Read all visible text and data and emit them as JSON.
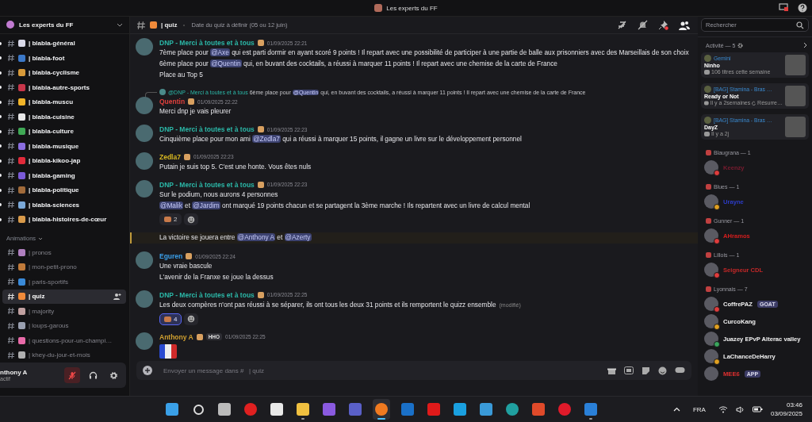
{
  "window": {
    "title": "Les experts du FF"
  },
  "server": {
    "name": "Les experts du FF"
  },
  "channels": [
    {
      "name": "| blabla-général",
      "unread": true,
      "selected": false,
      "color": "#d9d9e8"
    },
    {
      "name": "| blabla-foot",
      "unread": true,
      "selected": false,
      "color": "#3b78c8"
    },
    {
      "name": "| blabla-cyclisme",
      "unread": true,
      "selected": false,
      "color": "#d79a3a"
    },
    {
      "name": "| blabla-autre-sports",
      "unread": true,
      "selected": false,
      "color": "#c8364a"
    },
    {
      "name": "| blabla-muscu",
      "unread": true,
      "selected": false,
      "color": "#f0b429"
    },
    {
      "name": "| blabla-cuisine",
      "unread": true,
      "selected": false,
      "color": "#e8e8e8"
    },
    {
      "name": "| blabla-culture",
      "unread": true,
      "selected": false,
      "color": "#3fa855"
    },
    {
      "name": "| blabla-musique",
      "unread": true,
      "selected": false,
      "color": "#8a6de0"
    },
    {
      "name": "| blabla-kikoo-jap",
      "unread": true,
      "selected": false,
      "color": "#e02a3a"
    },
    {
      "name": "| blabla-gaming",
      "unread": true,
      "selected": false,
      "color": "#7a5ad8"
    },
    {
      "name": "| blabla-politique",
      "unread": true,
      "selected": false,
      "color": "#a06a3a"
    },
    {
      "name": "| blabla-sciences",
      "unread": true,
      "selected": false,
      "color": "#7aa8d8"
    },
    {
      "name": "| blabla-histoires-de-cœur",
      "unread": true,
      "selected": false,
      "color": "#d89a4a"
    }
  ],
  "category": {
    "name": "Animations",
    "channels": [
      {
        "name": "| pronos",
        "unread": false,
        "selected": false,
        "color": "#b080c0"
      },
      {
        "name": "| mon-petit-prono",
        "unread": false,
        "selected": false,
        "color": "#c07a3a"
      },
      {
        "name": "| paris-sportifs",
        "unread": false,
        "selected": false,
        "color": "#3a8ad8"
      },
      {
        "name": "| quiz",
        "unread": true,
        "selected": true,
        "color": "#f08a3a"
      },
      {
        "name": "| majority",
        "unread": false,
        "selected": false,
        "color": "#c0a0a0"
      },
      {
        "name": "| loups-garous",
        "unread": false,
        "selected": false,
        "color": "#9aa0b0"
      },
      {
        "name": "| questions-pour-un-champi…",
        "unread": false,
        "selected": false,
        "color": "#e86aa8"
      },
      {
        "name": "| khey-du-jour-et-mois",
        "unread": false,
        "selected": false,
        "color": "#b0b0b0"
      }
    ]
  },
  "user_panel": {
    "name": "nthony A",
    "status": "actif",
    "muted": true
  },
  "chat_header": {
    "channel": "| quiz",
    "topic": "Date du quiz à définir (05 ou 12 juin)"
  },
  "search": {
    "placeholder": "Rechercher"
  },
  "messages": [
    {
      "kind": "message",
      "author": "DNP - Merci à toutes et à tous",
      "color": "#2bb8a8",
      "time": "01/09/2025 22:21",
      "lines": [
        [
          {
            "text": "7ème place pour ",
            "mention": false
          },
          {
            "text": "@Axe",
            "mention": true
          },
          {
            "text": " qui est parti dormir en ayant scoré 9 points ! Il repart avec une possibilité de participer à une partie de balle aux prisonniers avec des Marseillais de son choix",
            "mention": false
          }
        ],
        [
          {
            "text": "6ème place pour ",
            "mention": false
          },
          {
            "text": "@Quentin",
            "mention": true
          },
          {
            "text": " qui, en buvant des cocktails, a réussi à marquer 11 points ! Il repart avec une chemise de la carte de France",
            "mention": false
          }
        ],
        [
          {
            "text": "Place au Top 5",
            "mention": false
          }
        ]
      ]
    },
    {
      "kind": "message",
      "author": "Quentin",
      "color": "#e0403c",
      "time": "01/09/2025 22:22",
      "reply": {
        "author": "@DNP - Merci à toutes et à tous",
        "parts": [
          {
            "text": "6ème place pour ",
            "mention": false
          },
          {
            "text": "@Quentin",
            "mention": true
          },
          {
            "text": " qui, en buvant des cocktails, a réussi à marquer 11 points ! Il repart avec une chemise de la carte de France",
            "mention": false
          }
        ]
      },
      "lines": [
        [
          {
            "text": "Merci dnp je vais pleurer",
            "mention": false
          }
        ]
      ]
    },
    {
      "kind": "message",
      "author": "DNP - Merci à toutes et à tous",
      "color": "#2bb8a8",
      "time": "01/09/2025 22:23",
      "lines": [
        [
          {
            "text": "Cinquième place pour mon ami ",
            "mention": false
          },
          {
            "text": "@Zedla7",
            "mention": true
          },
          {
            "text": " qui a réussi à marquer 15 points, il gagne un livre sur le développement personnel",
            "mention": false
          }
        ]
      ]
    },
    {
      "kind": "message",
      "author": "Zedla7",
      "color": "#d8b820",
      "time": "01/09/2025 22:23",
      "lines": [
        [
          {
            "text": "Putain je suis top 5. C'est une honte. Vous êtes nuls",
            "mention": false
          }
        ]
      ]
    },
    {
      "kind": "message",
      "author": "DNP - Merci à toutes et à tous",
      "color": "#2bb8a8",
      "time": "01/09/2025 22:23",
      "lines": [
        [
          {
            "text": "Sur le podium, nous aurons 4 personnes",
            "mention": false
          }
        ],
        [
          {
            "text": "@Malik",
            "mention": true
          },
          {
            "text": " et ",
            "mention": false
          },
          {
            "text": "@Jardim",
            "mention": true
          },
          {
            "text": " ont marqué 19 points chacun et se partagent la 3ème marche ! Ils repartent avec un livre de calcul mental",
            "mention": false
          }
        ]
      ],
      "reactions": [
        {
          "count": "2",
          "selected": false
        }
      ]
    },
    {
      "kind": "highlight",
      "lines": [
        [
          {
            "text": "La victoire se jouera entre ",
            "mention": false
          },
          {
            "text": "@Anthony A",
            "mention": true
          },
          {
            "text": " et ",
            "mention": false
          },
          {
            "text": "@Azerty",
            "mention": true
          }
        ]
      ]
    },
    {
      "kind": "message",
      "author": "Eguren",
      "color": "#3a9ee8",
      "time": "01/09/2025 22:24",
      "lines": [
        [
          {
            "text": "Une vraie bascule",
            "mention": false
          }
        ],
        [
          {
            "text": "L'avenir de la Franxe se joue la dessus",
            "mention": false
          }
        ]
      ]
    },
    {
      "kind": "message",
      "author": "DNP - Merci à toutes et à tous",
      "color": "#2bb8a8",
      "time": "01/09/2025 22:25",
      "lines": [
        [
          {
            "text": "Les deux compères n'ont pas réussi à se séparer, ils ont tous les deux 31 points et ils remportent le quizz ensemble",
            "mention": false
          }
        ]
      ],
      "edited": "(modifié)",
      "reactions": [
        {
          "count": "4",
          "selected": true
        }
      ]
    },
    {
      "kind": "message",
      "author": "Anthony A",
      "color": "#d0a030",
      "time": "01/09/2025 22:25",
      "tag": "HHO",
      "sticker": true
    }
  ],
  "composer": {
    "placeholder": "Envoyer un message dans #   | quiz"
  },
  "activity": {
    "title": "Activité — 5",
    "cards": [
      {
        "user": "Gemini",
        "title": "Ninho",
        "detail": "106 titres cette semaine"
      },
      {
        "user": "[BAG] Stamina - Bras …",
        "title": "Ready or Not",
        "detail": "Il y a 2semaines",
        "extra": "Résurre…"
      },
      {
        "user": "[BAG] Stamina - Bras …",
        "title": "DayZ",
        "detail": "Il y a 2j"
      }
    ]
  },
  "member_groups": [
    {
      "name": "Blaugrana — 1",
      "members": [
        {
          "name": "Keenzy",
          "color": "#7a1c30",
          "kind": "dnd"
        }
      ]
    },
    {
      "name": "Blues — 1",
      "members": [
        {
          "name": "Urayne",
          "color": "#2c3cc8",
          "kind": "idle"
        }
      ]
    },
    {
      "name": "Gunner — 1",
      "members": [
        {
          "name": "AHramos",
          "color": "#d41e1e",
          "kind": "dnd"
        }
      ]
    },
    {
      "name": "Lillois — 1",
      "members": [
        {
          "name": "Seigneur CDL",
          "color": "#c42828",
          "kind": "dnd"
        }
      ]
    },
    {
      "name": "Lyonnais — 7",
      "members": [
        {
          "name": "CoffrePAZ",
          "color": "#f0f0f0",
          "kind": "dnd",
          "tag": "GOAT"
        },
        {
          "name": "CurcoKang",
          "color": "#f0f0f0",
          "kind": "idle"
        },
        {
          "name": "Juazey EPvP Alterac valley",
          "color": "#f0f0f0",
          "kind": "online"
        },
        {
          "name": "LaChanceDeHarry",
          "color": "#f0f0f0",
          "kind": "idle"
        },
        {
          "name": "MEE6",
          "color": "#e03030",
          "kind": "bot",
          "tag": "APP"
        }
      ]
    }
  ],
  "taskbar": {
    "apps": [
      {
        "kind": "start",
        "running": false,
        "selected": false
      },
      {
        "kind": "search",
        "running": false,
        "selected": false
      },
      {
        "kind": "taskview",
        "running": false,
        "selected": false
      },
      {
        "kind": "record",
        "running": false,
        "selected": false
      },
      {
        "kind": "file",
        "running": false,
        "selected": false
      },
      {
        "kind": "folder",
        "running": true,
        "selected": false
      },
      {
        "kind": "m365",
        "running": false,
        "selected": false
      },
      {
        "kind": "teams",
        "running": false,
        "selected": false
      },
      {
        "kind": "firefox",
        "running": true,
        "selected": true
      },
      {
        "kind": "outlook",
        "running": false,
        "selected": false
      },
      {
        "kind": "tlc",
        "running": false,
        "selected": false
      },
      {
        "kind": "mybp",
        "running": false,
        "selected": false
      },
      {
        "kind": "store",
        "running": false,
        "selected": false
      },
      {
        "kind": "edge",
        "running": false,
        "selected": false
      },
      {
        "kind": "ccleaner",
        "running": false,
        "selected": false
      },
      {
        "kind": "opera",
        "running": false,
        "selected": false
      },
      {
        "kind": "docs",
        "running": true,
        "selected": false
      }
    ],
    "language": "FRA",
    "time": "03:46",
    "date": "03/09/2025"
  }
}
